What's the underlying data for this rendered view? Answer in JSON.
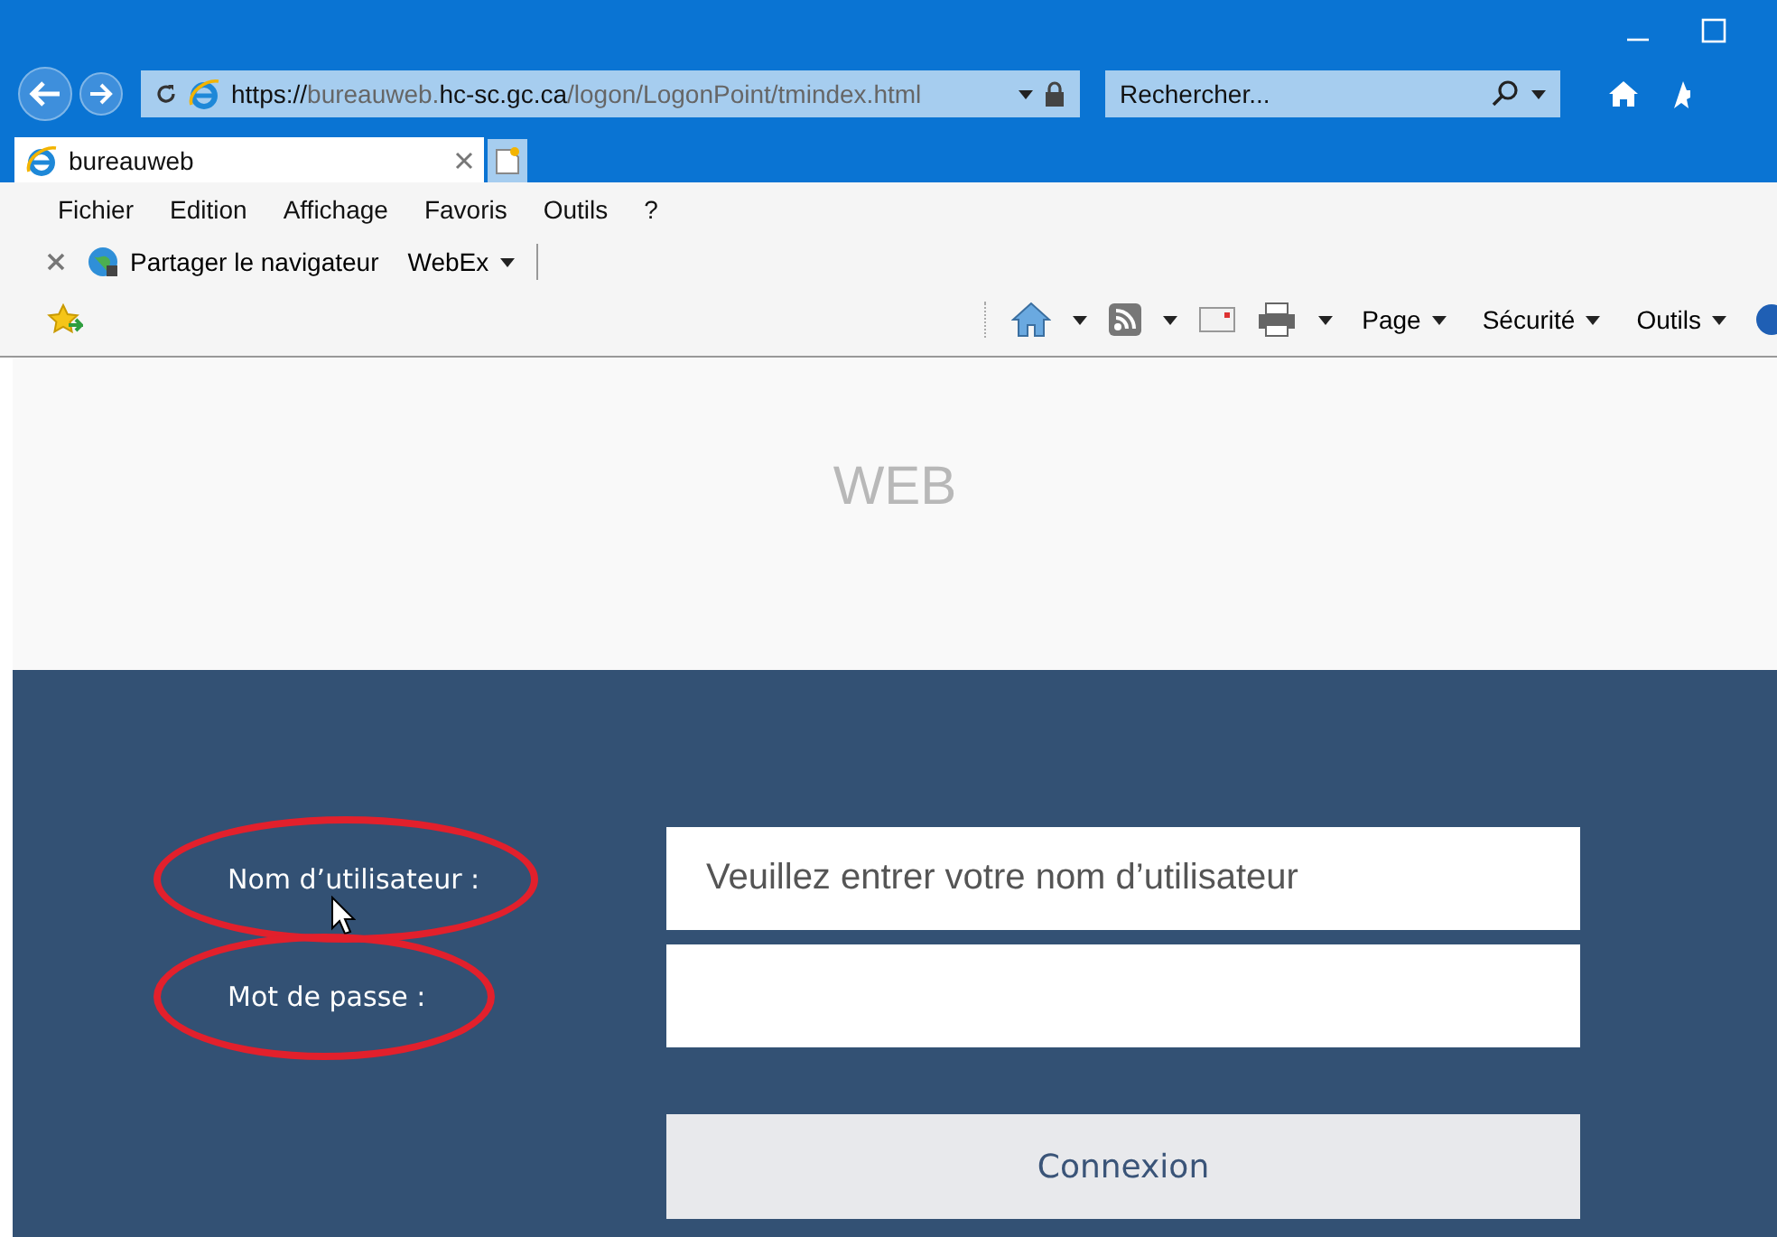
{
  "browser": {
    "address": {
      "url_parts": [
        {
          "text": "https://",
          "highlight": true
        },
        {
          "text": "bureauweb.",
          "highlight": false
        },
        {
          "text": "hc-sc.gc.ca",
          "highlight": true
        },
        {
          "text": "/logon/LogonPoint/tmindex.html",
          "highlight": false
        }
      ]
    },
    "search": {
      "placeholder": "Rechercher..."
    },
    "tabs": [
      {
        "label": "bureauweb",
        "selected": true
      }
    ],
    "menu": [
      "Fichier",
      "Edition",
      "Affichage",
      "Favoris",
      "Outils",
      "?"
    ],
    "links_bar": [
      "Partager le navigateur",
      "WebEx"
    ],
    "command_bar": [
      "Page",
      "Sécurité",
      "Outils"
    ]
  },
  "page": {
    "logo": "WEB",
    "fields": [
      {
        "label": "Nom d’utilisateur :",
        "placeholder": "Veuillez entrer votre nom d’utilisateur",
        "annotated": true,
        "kind": "text"
      },
      {
        "label": "Mot de passe :",
        "annotated": true,
        "kind": "password"
      }
    ],
    "button": "Connexion"
  }
}
